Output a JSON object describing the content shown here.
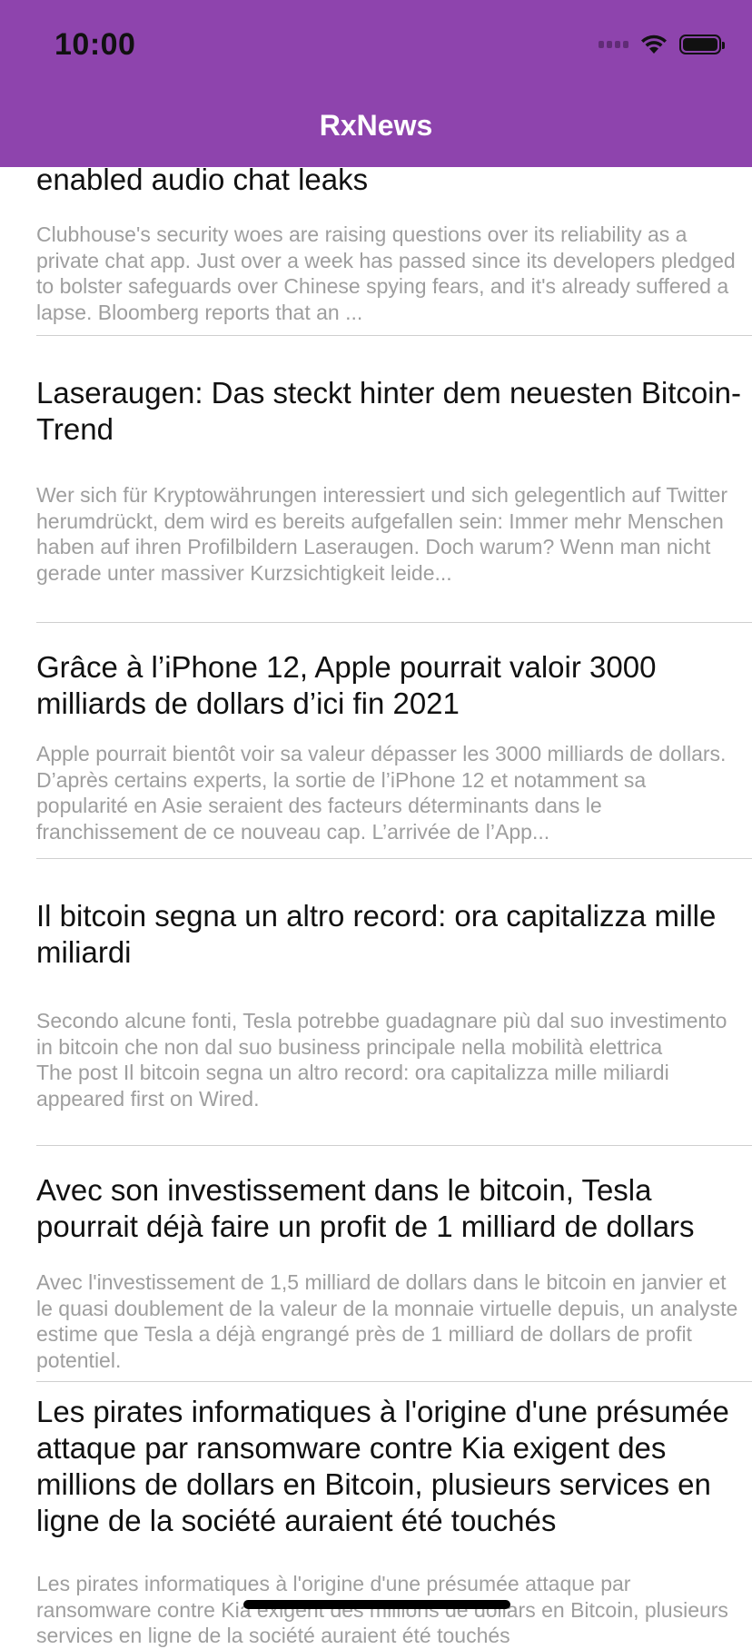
{
  "status_bar": {
    "time": "10:00"
  },
  "nav": {
    "title": "RxNews"
  },
  "articles": [
    {
      "title": "enabled audio chat leaks",
      "summary": "Clubhouse's security woes are raising questions over its reliability as a private chat app. Just over a week has passed since its developers pledged to bolster safeguards over Chinese spying fears, and it's already suffered a lapse. Bloomberg reports that an ..."
    },
    {
      "title": "Laseraugen: Das steckt hinter dem neuesten Bitcoin-Trend",
      "summary": "Wer sich für Kryptowährungen interessiert und sich gelegentlich auf Twitter herumdrückt, dem wird es bereits aufgefallen sein: Immer mehr Menschen haben auf ihren Profilbildern Laseraugen. Doch warum? Wenn man nicht gerade unter massiver Kurzsichtigkeit leide..."
    },
    {
      "title": "Grâce à l’iPhone 12, Apple pourrait valoir 3000 milliards de dollars d’ici fin 2021",
      "summary": "Apple pourrait bientôt voir sa valeur dépasser les 3000 milliards de dollars. D’après certains experts, la sortie de l’iPhone 12 et notamment sa popularité en Asie seraient des facteurs déterminants dans le franchissement de ce nouveau cap. L’arrivée de l’App..."
    },
    {
      "title": "Il bitcoin segna un altro record: ora capitalizza mille miliardi",
      "summary": "Secondo alcune fonti, Tesla potrebbe guadagnare più dal suo investimento in bitcoin che non dal suo business principale nella mobilità elettrica\nThe post Il bitcoin segna un altro record: ora capitalizza mille miliardi appeared first on Wired."
    },
    {
      "title": "Avec son investissement dans le bitcoin, Tesla pourrait déjà faire un profit de 1 milliard de dollars",
      "summary": "Avec l'investissement de 1,5 milliard de dollars dans le bitcoin en janvier et le quasi doublement de la valeur de la monnaie virtuelle depuis, un analyste estime que Tesla a déjà engrangé près de 1 milliard de dollars de profit potentiel."
    },
    {
      "title": "Les pirates informatiques à l'origine d'une présumée attaque par ransomware contre Kia exigent des millions de dollars en Bitcoin, plusieurs services en ligne de la société auraient été touchés",
      "summary": "Les pirates informatiques à l'origine d'une présumée attaque par ransomware contre Kia exigent des millions de dollars en Bitcoin, plusieurs services en ligne de la société auraient été touchés"
    }
  ]
}
